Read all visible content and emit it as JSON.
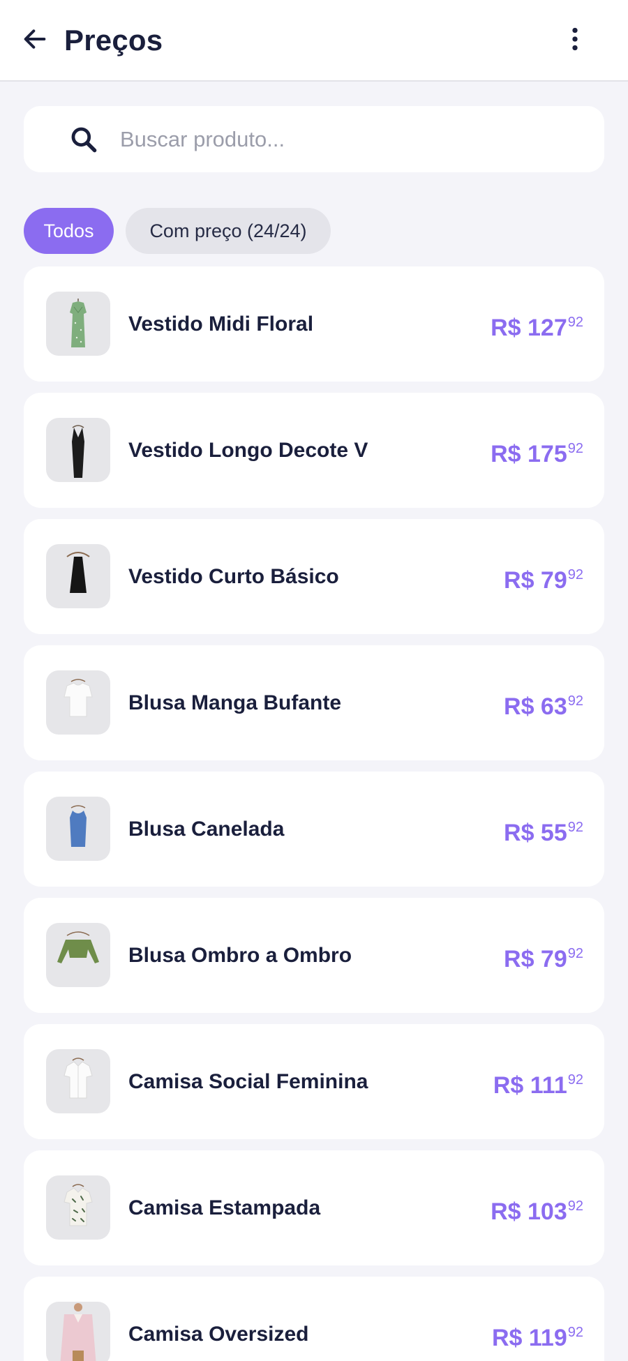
{
  "header": {
    "title": "Preços",
    "back_icon": "arrow-left-icon",
    "menu_icon": "more-vertical-icon"
  },
  "search": {
    "placeholder": "Buscar produto...",
    "value": "",
    "icon": "search-icon"
  },
  "filters": [
    {
      "label": "Todos",
      "selected": true
    },
    {
      "label": "Com preço (24/24)",
      "selected": false
    }
  ],
  "colors": {
    "accent": "#8b6cf0",
    "text": "#1a1f3c",
    "background": "#f4f4f9",
    "card": "#ffffff"
  },
  "products": [
    {
      "name": "Vestido Midi Floral",
      "price_main": "R$ 127",
      "price_cents": "92",
      "thumb_icon": "green-dress-icon"
    },
    {
      "name": "Vestido Longo Decote V",
      "price_main": "R$ 175",
      "price_cents": "92",
      "thumb_icon": "black-long-dress-icon"
    },
    {
      "name": "Vestido Curto Básico",
      "price_main": "R$ 79",
      "price_cents": "92",
      "thumb_icon": "black-short-dress-icon"
    },
    {
      "name": "Blusa Manga Bufante",
      "price_main": "R$ 63",
      "price_cents": "92",
      "thumb_icon": "white-blouse-icon"
    },
    {
      "name": "Blusa Canelada",
      "price_main": "R$ 55",
      "price_cents": "92",
      "thumb_icon": "blue-tank-top-icon"
    },
    {
      "name": "Blusa Ombro a Ombro",
      "price_main": "R$ 79",
      "price_cents": "92",
      "thumb_icon": "green-crop-blouse-icon"
    },
    {
      "name": "Camisa Social Feminina",
      "price_main": "R$ 111",
      "price_cents": "92",
      "thumb_icon": "white-shirt-icon"
    },
    {
      "name": "Camisa Estampada",
      "price_main": "R$ 103",
      "price_cents": "92",
      "thumb_icon": "printed-shirt-icon"
    },
    {
      "name": "Camisa Oversized",
      "price_main": "R$ 119",
      "price_cents": "92",
      "thumb_icon": "pink-oversized-shirt-icon"
    }
  ]
}
